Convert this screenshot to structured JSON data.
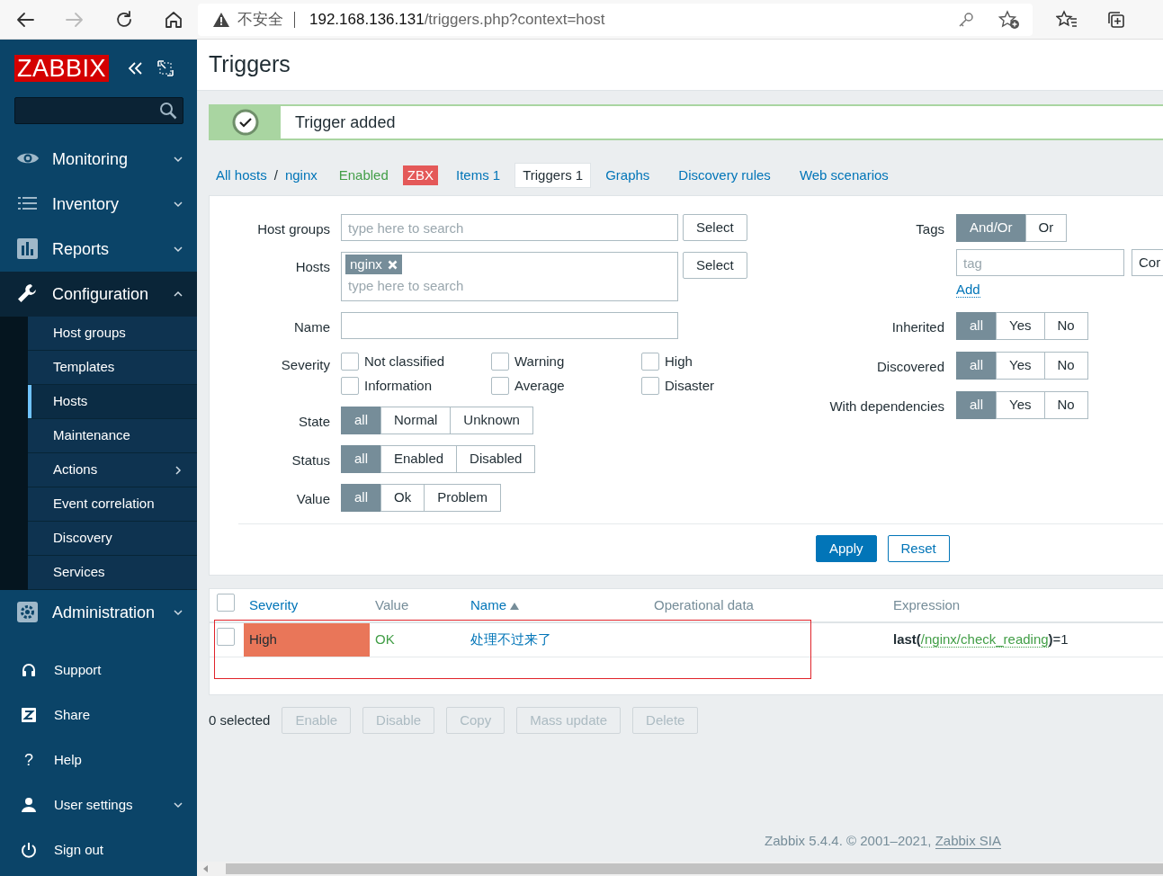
{
  "browser": {
    "security_label": "不安全",
    "url_host": "192.168.136.131",
    "url_path": "/triggers.php?context=host",
    "forward_disabled": true
  },
  "sidebar": {
    "logo": "ZABBIX",
    "menu": [
      {
        "label": "Monitoring",
        "has_submenu": true,
        "expanded": false
      },
      {
        "label": "Inventory",
        "has_submenu": true,
        "expanded": false
      },
      {
        "label": "Reports",
        "has_submenu": true,
        "expanded": false
      },
      {
        "label": "Configuration",
        "has_submenu": true,
        "expanded": true,
        "children": [
          {
            "label": "Host groups",
            "selected": false,
            "has_submenu": false
          },
          {
            "label": "Templates",
            "selected": false,
            "has_submenu": false
          },
          {
            "label": "Hosts",
            "selected": true,
            "has_submenu": false
          },
          {
            "label": "Maintenance",
            "selected": false,
            "has_submenu": false
          },
          {
            "label": "Actions",
            "selected": false,
            "has_submenu": true
          },
          {
            "label": "Event correlation",
            "selected": false,
            "has_submenu": false
          },
          {
            "label": "Discovery",
            "selected": false,
            "has_submenu": false
          },
          {
            "label": "Services",
            "selected": false,
            "has_submenu": false
          }
        ]
      },
      {
        "label": "Administration",
        "has_submenu": true,
        "expanded": false
      }
    ],
    "bottom_menu": [
      {
        "label": "Support",
        "has_submenu": false
      },
      {
        "label": "Share",
        "has_submenu": false
      },
      {
        "label": "Help",
        "icon_text": "?",
        "has_submenu": false
      },
      {
        "label": "User settings",
        "has_submenu": true
      },
      {
        "label": "Sign out",
        "has_submenu": false
      }
    ]
  },
  "page": {
    "title": "Triggers",
    "message": "Trigger added"
  },
  "host_nav": {
    "breadcrumbs": [
      "All hosts",
      "nginx"
    ],
    "separator": "/",
    "status": "Enabled",
    "badge": "ZBX",
    "tabs": [
      {
        "label": "Items 1",
        "selected": false
      },
      {
        "label": "Triggers 1",
        "selected": true
      },
      {
        "label": "Graphs",
        "selected": false
      },
      {
        "label": "Discovery rules",
        "selected": false
      },
      {
        "label": "Web scenarios",
        "selected": false
      }
    ]
  },
  "filter": {
    "host_groups": {
      "label": "Host groups",
      "placeholder": "type here to search",
      "button": "Select"
    },
    "hosts": {
      "label": "Hosts",
      "chips": [
        "nginx"
      ],
      "placeholder": "type here to search",
      "button": "Select"
    },
    "name": {
      "label": "Name"
    },
    "severity": {
      "label": "Severity",
      "options": [
        {
          "label": "Not classified",
          "checked": false
        },
        {
          "label": "Warning",
          "checked": false
        },
        {
          "label": "High",
          "checked": false
        },
        {
          "label": "Information",
          "checked": false
        },
        {
          "label": "Average",
          "checked": false
        },
        {
          "label": "Disaster",
          "checked": false
        }
      ]
    },
    "segments": [
      {
        "label": "State",
        "options": [
          {
            "label": "all",
            "selected": true
          },
          {
            "label": "Normal",
            "selected": false
          },
          {
            "label": "Unknown",
            "selected": false
          }
        ]
      },
      {
        "label": "Status",
        "options": [
          {
            "label": "all",
            "selected": true
          },
          {
            "label": "Enabled",
            "selected": false
          },
          {
            "label": "Disabled",
            "selected": false
          }
        ]
      },
      {
        "label": "Value",
        "options": [
          {
            "label": "all",
            "selected": true
          },
          {
            "label": "Ok",
            "selected": false
          },
          {
            "label": "Problem",
            "selected": false
          }
        ]
      }
    ],
    "tags": {
      "label": "Tags",
      "options": [
        {
          "label": "And/Or",
          "selected": true
        },
        {
          "label": "Or",
          "selected": false
        }
      ],
      "placeholder": "tag",
      "operator": "Cor",
      "add": "Add"
    },
    "right_segments": [
      {
        "label": "Inherited",
        "options": [
          {
            "label": "all",
            "selected": true
          },
          {
            "label": "Yes",
            "selected": false
          },
          {
            "label": "No",
            "selected": false
          }
        ]
      },
      {
        "label": "Discovered",
        "options": [
          {
            "label": "all",
            "selected": true
          },
          {
            "label": "Yes",
            "selected": false
          },
          {
            "label": "No",
            "selected": false
          }
        ]
      },
      {
        "label": "With dependencies",
        "options": [
          {
            "label": "all",
            "selected": true
          },
          {
            "label": "Yes",
            "selected": false
          },
          {
            "label": "No",
            "selected": false
          }
        ]
      }
    ],
    "apply": "Apply",
    "reset": "Reset"
  },
  "table": {
    "select_all": false,
    "columns": [
      {
        "label": "Severity",
        "sortable": true,
        "sorted": false
      },
      {
        "label": "Value",
        "sortable": false,
        "sorted": false
      },
      {
        "label": "Name",
        "sortable": true,
        "sorted": true
      },
      {
        "label": "Operational data",
        "sortable": false,
        "sorted": false
      },
      {
        "label": "Expression",
        "sortable": false,
        "sorted": false
      }
    ],
    "rows": [
      {
        "checked": false,
        "severity": "High",
        "color": "#e97659",
        "value": "OK",
        "value_ok": true,
        "name": "处理不过来了",
        "highlighted": true,
        "expression": [
          {
            "kind": "function",
            "text": "last("
          },
          {
            "kind": "item",
            "text": "/nginx/check_reading"
          },
          {
            "kind": "function",
            "text": ")"
          },
          {
            "kind": "plain",
            "text": "=1"
          }
        ]
      }
    ]
  },
  "actions": {
    "selected_count": "0 selected",
    "buttons": [
      {
        "label": "Enable",
        "disabled": true
      },
      {
        "label": "Disable",
        "disabled": true
      },
      {
        "label": "Copy",
        "disabled": true
      },
      {
        "label": "Mass update",
        "disabled": true
      },
      {
        "label": "Delete",
        "disabled": true
      }
    ]
  },
  "footer": {
    "text": "Zabbix 5.4.4. © 2001–2021, ",
    "link": "Zabbix SIA"
  }
}
